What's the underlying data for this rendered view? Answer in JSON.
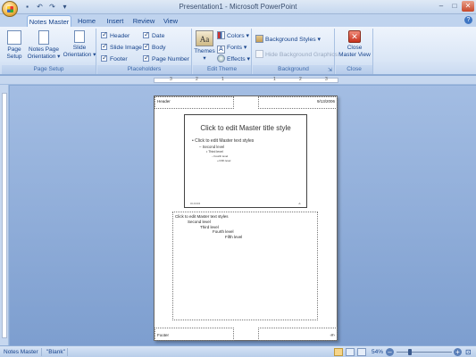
{
  "window": {
    "title": "Presentation1 - Microsoft PowerPoint"
  },
  "qat": {
    "save_icon": "save-icon",
    "undo_icon": "undo-icon",
    "redo_icon": "redo-icon"
  },
  "tabs": [
    {
      "label": "Notes Master",
      "active": true
    },
    {
      "label": "Home"
    },
    {
      "label": "Insert"
    },
    {
      "label": "Review"
    },
    {
      "label": "View"
    }
  ],
  "ribbon": {
    "page_setup": {
      "label": "Page Setup",
      "page_setup_btn": "Page Setup",
      "notes_orientation_btn_line1": "Notes Page",
      "notes_orientation_btn_line2": "Orientation ▾",
      "slide_orientation_btn_line1": "Slide",
      "slide_orientation_btn_line2": "Orientation ▾"
    },
    "placeholders": {
      "label": "Placeholders",
      "header": "Header",
      "slide_image": "Slide Image",
      "footer": "Footer",
      "date": "Date",
      "body": "Body",
      "page_number": "Page Number"
    },
    "edit_theme": {
      "label": "Edit Theme",
      "themes": "Themes",
      "themes_icon_text": "Aa",
      "colors": "Colors ▾",
      "fonts": "Fonts ▾",
      "effects": "Effects ▾"
    },
    "background": {
      "label": "Background",
      "background_styles": "Background Styles ▾",
      "hide_background_graphics": "Hide Background Graphics"
    },
    "close": {
      "label": "Close",
      "close_btn_line1": "Close",
      "close_btn_line2": "Master View"
    }
  },
  "page": {
    "header": "Header",
    "date": "9/13/2006",
    "footer": "Footer",
    "page_number": "‹#›",
    "slide": {
      "title": "Click to edit Master title style",
      "bullets": [
        "• Click to edit Master text styles",
        "– Second level",
        "• Third level",
        "– Fourth level",
        "» Fifth level"
      ],
      "footer_left": "9/13/2006",
      "footer_right": "‹#›"
    },
    "notes": [
      "Click to edit Master text styles",
      "Second level",
      "Third level",
      "Fourth level",
      "Fifth level"
    ]
  },
  "status": {
    "view": "Notes Master",
    "theme": "\"Blank\"",
    "zoom": "54%",
    "zoom_fraction": 0.54
  }
}
